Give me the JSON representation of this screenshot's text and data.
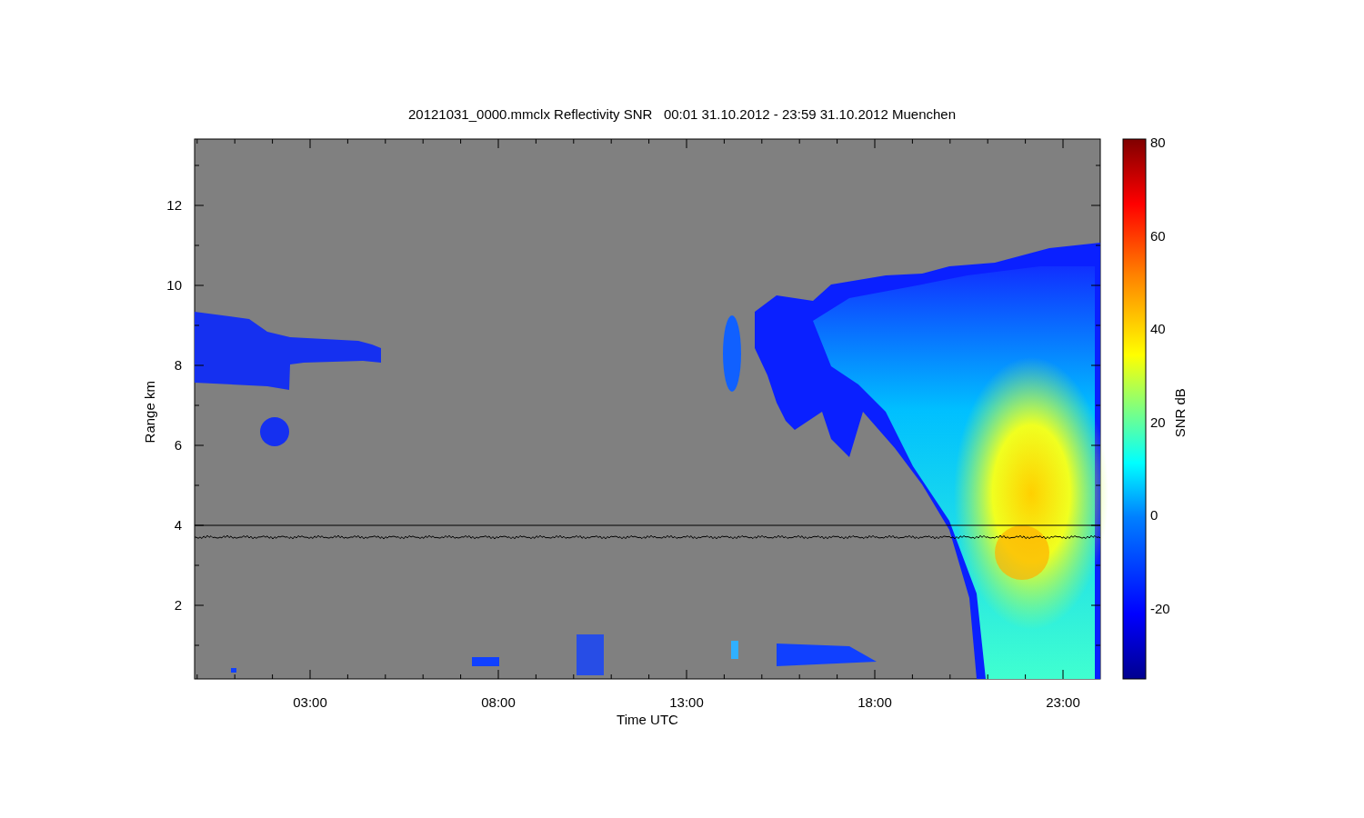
{
  "title": "20121031_0000.mmclx Reflectivity SNR   00:01 31.10.2012 - 23:59 31.10.2012 Muenchen",
  "plot": {
    "xlabel": "Time UTC",
    "ylabel": "Range km",
    "xticks": [
      "03:00",
      "08:00",
      "13:00",
      "18:00",
      "23:00"
    ],
    "yticks": [
      "12",
      "10",
      "8",
      "6",
      "4",
      "2"
    ]
  },
  "colorbar": {
    "label": "SNR dB",
    "ticks": [
      "80",
      "60",
      "40",
      "20",
      "0",
      "-20"
    ]
  }
}
